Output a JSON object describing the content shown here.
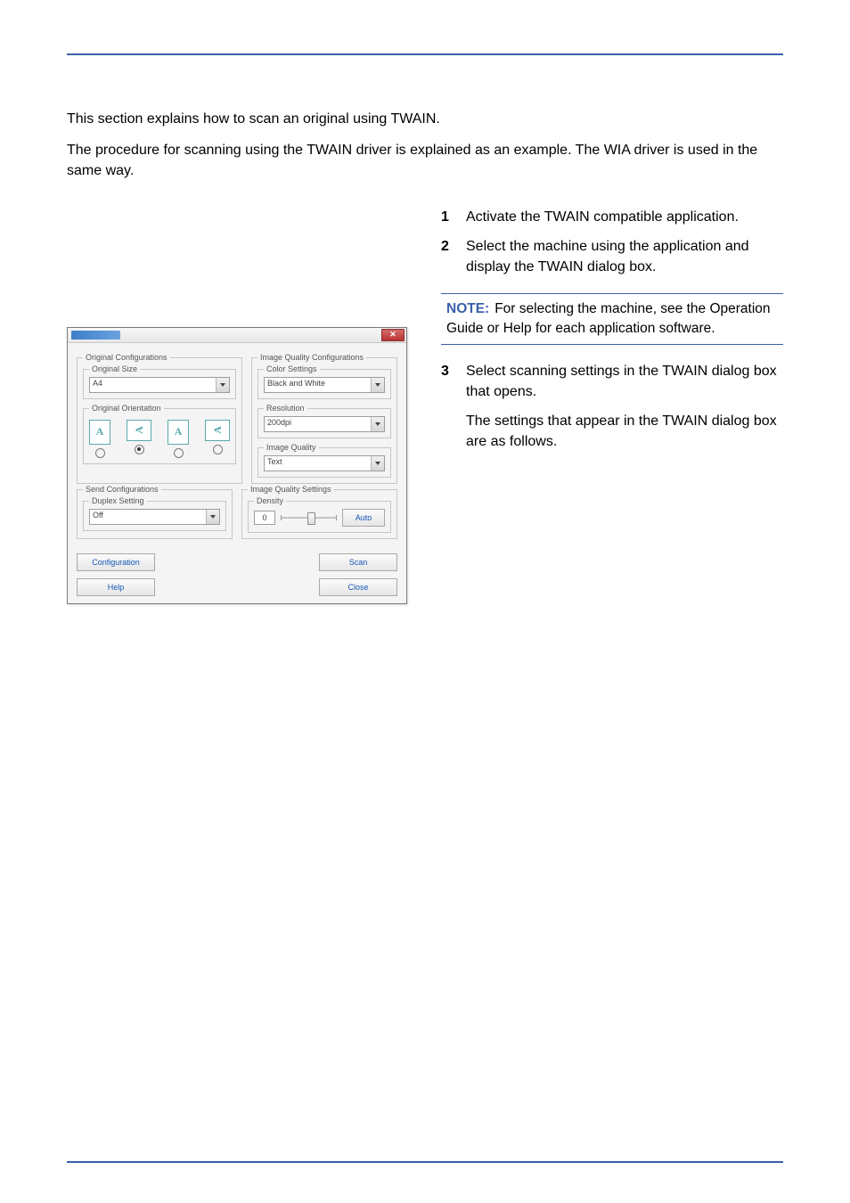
{
  "intro": {
    "p1": "This section explains how to scan an original using TWAIN.",
    "p2": "The procedure for scanning using the TWAIN driver is explained as an example. The WIA driver is used in the same way."
  },
  "steps": {
    "s1": {
      "num": "1",
      "text": "Activate the TWAIN compatible application."
    },
    "s2": {
      "num": "2",
      "text": "Select the machine using the application and display the TWAIN dialog box."
    },
    "s3": {
      "num": "3",
      "text": "Select scanning settings in the TWAIN dialog box that opens."
    },
    "s3b": "The settings that appear in the TWAIN dialog box are as follows."
  },
  "note": {
    "label": "NOTE:",
    "text": "For selecting the machine, see the Operation Guide or Help for each application software."
  },
  "dialog": {
    "groups": {
      "orig_conf": "Original Configurations",
      "orig_size": "Original Size",
      "orig_orient": "Original Orientation",
      "send_conf": "Send Configurations",
      "duplex": "Duplex Setting",
      "iq_conf": "Image Quality Configurations",
      "color": "Color Settings",
      "res": "Resolution",
      "iq": "Image Quality",
      "iq_set": "Image Quality Settings",
      "density": "Density"
    },
    "values": {
      "orig_size": "A4",
      "duplex": "Off",
      "color": "Black and White",
      "res": "200dpi",
      "iq": "Text",
      "density": "0"
    },
    "buttons": {
      "auto": "Auto",
      "configuration": "Configuration",
      "help": "Help",
      "scan": "Scan",
      "close": "Close"
    },
    "glyph_A": "A"
  }
}
